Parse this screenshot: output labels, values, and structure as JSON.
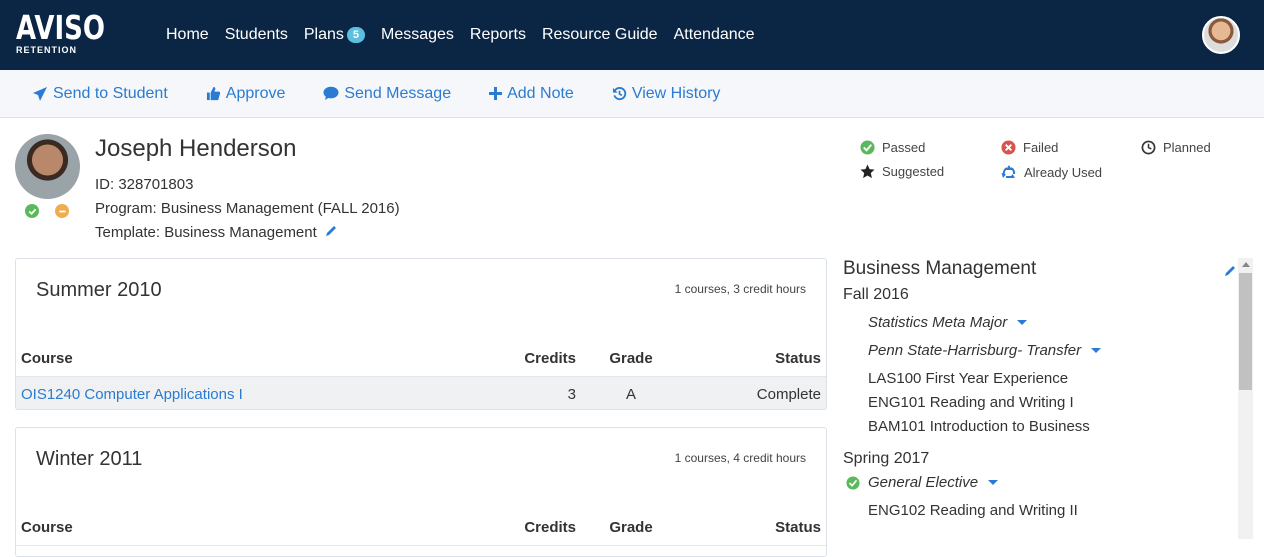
{
  "app": {
    "logo_line1": "AVISO",
    "logo_line2": "RETENTION"
  },
  "nav": {
    "items": [
      {
        "label": "Home"
      },
      {
        "label": "Students"
      },
      {
        "label": "Plans",
        "badge": "5"
      },
      {
        "label": "Messages"
      },
      {
        "label": "Reports"
      },
      {
        "label": "Resource Guide"
      },
      {
        "label": "Attendance"
      }
    ]
  },
  "actions": {
    "send_to_student": "Send to Student",
    "approve": "Approve",
    "send_message": "Send Message",
    "add_note": "Add Note",
    "view_history": "View History"
  },
  "student": {
    "name": "Joseph Henderson",
    "id": "ID: 328701803",
    "program": "Program: Business Management (FALL 2016)",
    "template": "Template: Business Management"
  },
  "legend": {
    "passed": "Passed",
    "failed": "Failed",
    "planned": "Planned",
    "suggested": "Suggested",
    "already_used": "Already Used"
  },
  "columns": {
    "course": "Course",
    "credits": "Credits",
    "grade": "Grade",
    "status": "Status"
  },
  "terms": [
    {
      "title": "Summer 2010",
      "summary": "1 courses, 3 credit hours",
      "rows": [
        {
          "course": "OIS1240 Computer Applications I",
          "credits": "3",
          "grade": "A",
          "status": "Complete"
        }
      ]
    },
    {
      "title": "Winter 2011",
      "summary": "1 courses, 4 credit hours",
      "rows": []
    }
  ],
  "plan": {
    "title": "Business Management",
    "semesters": [
      {
        "name": "Fall 2016",
        "requirements": [
          "Statistics Meta Major",
          "Penn State-Harrisburg- Transfer"
        ],
        "courses": [
          "LAS100 First Year Experience",
          "ENG101 Reading and Writing I",
          "BAM101 Introduction to Business"
        ]
      },
      {
        "name": "Spring 2017",
        "requirements": [
          "General Elective"
        ],
        "courses": [
          "ENG102 Reading and Writing II"
        ]
      }
    ]
  },
  "colors": {
    "navbar": "#0b2545",
    "accent": "#2a7bd1",
    "passed": "#5cb85c",
    "failed": "#d9534f",
    "recycle": "#2a7bd1",
    "badge": "#5bc0de"
  }
}
